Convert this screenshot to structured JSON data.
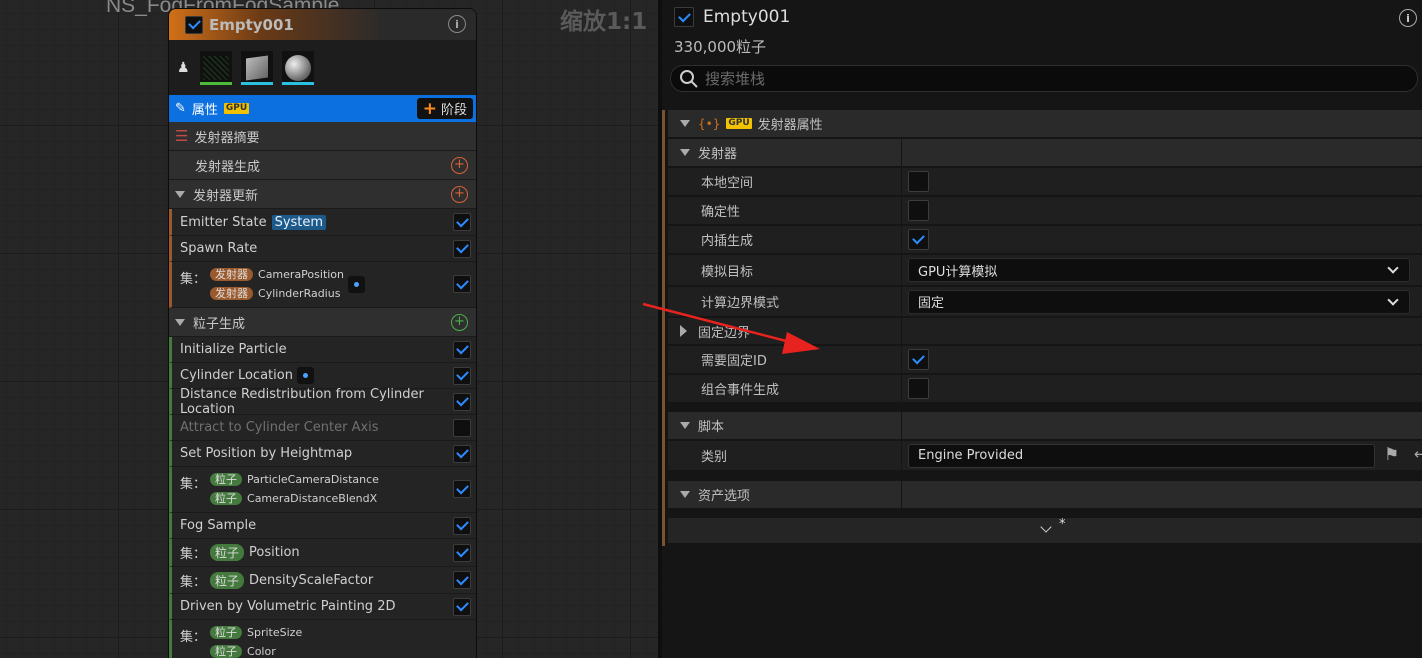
{
  "graph": {
    "title": "NS_FogFromFogSample",
    "zoom": "缩放1:1"
  },
  "node": {
    "name": "Empty001",
    "tab_label": "属性",
    "gpu_badge": "GPU",
    "stage_button": "阶段",
    "sections": {
      "summary": "发射器摘要",
      "emitter_spawn": "发射器生成",
      "emitter_update": "发射器更新",
      "particle_spawn": "粒子生成"
    },
    "modules": {
      "emitter_state": "Emitter State",
      "emitter_state_tag": "System",
      "spawn_rate": "Spawn Rate",
      "set_label": "集：",
      "emitter_pill": "发射器",
      "particle_pill": "粒子",
      "camera_position": "CameraPosition",
      "cylinder_radius": "CylinderRadius",
      "initialize_particle": "Initialize Particle",
      "cylinder_location": "Cylinder Location",
      "distance_redistribution": "Distance Redistribution from Cylinder Location",
      "attract_axis": "Attract to Cylinder Center Axis",
      "set_position_heightmap": "Set Position by Heightmap",
      "particle_camera_distance": "ParticleCameraDistance",
      "camera_distance_blend": "CameraDistanceBlendX",
      "fog_sample": "Fog Sample",
      "position": "Position",
      "density_scale": "DensityScaleFactor",
      "driven_by_painting": "Driven by Volumetric Painting 2D",
      "sprite_size": "SpriteSize",
      "color": "Color"
    }
  },
  "details": {
    "name": "Empty001",
    "particle_count": "330,000粒子",
    "search_placeholder": "搜索堆栈",
    "category_header": "发射器属性",
    "gpu_badge": "GPU",
    "emitter_group": "发射器",
    "local_space": "本地空间",
    "determinism": "确定性",
    "interpolated_spawn": "内插生成",
    "sim_target_label": "模拟目标",
    "sim_target_value": "GPU计算模拟",
    "bounds_mode_label": "计算边界模式",
    "bounds_mode_value": "固定",
    "fixed_bounds": "固定边界",
    "requires_persistent_id": "需要固定ID",
    "combine_event_spawn": "组合事件生成",
    "script_group": "脚本",
    "category_label": "类别",
    "category_value": "Engine Provided",
    "asset_options": "资产选项",
    "more_marker": "*"
  },
  "colors": {
    "accent": "#2b8cff",
    "tab_blue": "#0c70e0",
    "arrow_red": "#e8231f",
    "emitter_orange": "#9a5a2c",
    "particle_green": "#457a3e"
  }
}
